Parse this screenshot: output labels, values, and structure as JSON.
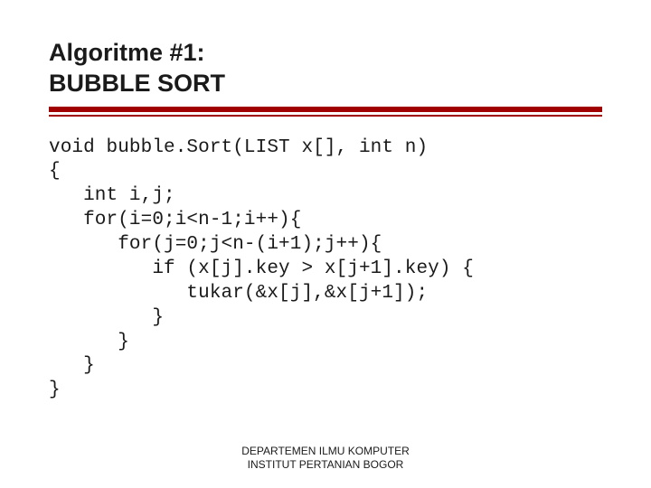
{
  "title": {
    "line1": "Algoritme #1:",
    "line2": "BUBBLE SORT"
  },
  "code_lines": [
    "void bubble.Sort(LIST x[], int n)",
    "{",
    "   int i,j;",
    "   for(i=0;i<n-1;i++){",
    "      for(j=0;j<n-(i+1);j++){",
    "         if (x[j].key > x[j+1].key) {",
    "            tukar(&x[j],&x[j+1]);",
    "         }",
    "      }",
    "   }",
    "}"
  ],
  "footer": {
    "line1": "DEPARTEMEN ILMU KOMPUTER",
    "line2": "INSTITUT PERTANIAN BOGOR"
  }
}
